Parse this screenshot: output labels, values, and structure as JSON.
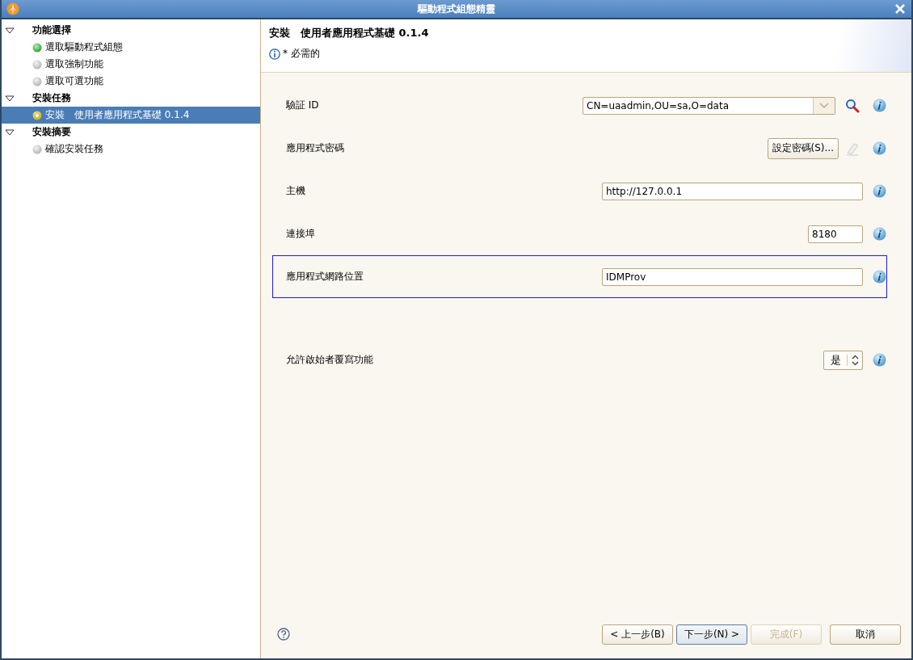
{
  "window": {
    "title": "驅動程式組態精靈"
  },
  "tree": [
    {
      "label": "功能選擇",
      "expanded": true,
      "children": [
        {
          "label": "選取驅動程式組態",
          "kind": "done",
          "selected": false
        },
        {
          "label": "選取強制功能",
          "kind": "pending",
          "selected": false
        },
        {
          "label": "選取可選功能",
          "kind": "pending",
          "selected": false
        }
      ]
    },
    {
      "label": "安裝任務",
      "expanded": true,
      "children": [
        {
          "label": "安裝　使用者應用程式基礎 0.1.4",
          "kind": "current",
          "selected": true
        }
      ]
    },
    {
      "label": "安裝摘要",
      "expanded": true,
      "children": [
        {
          "label": "確認安裝任務",
          "kind": "pending",
          "selected": false
        }
      ]
    }
  ],
  "header": {
    "title": "安裝　使用者應用程式基礎 0.1.4",
    "note": "* 必需的"
  },
  "fields": [
    {
      "kind": "combo",
      "label": "驗証 ID",
      "value": "CN=uaadmin,OU=sa,O=data",
      "focused": false
    },
    {
      "kind": "button",
      "label": "應用程式密碼",
      "value": "設定密碼(S)...",
      "focused": false
    },
    {
      "kind": "text",
      "label": "主機",
      "value": "http://127.0.0.1",
      "focused": false
    },
    {
      "kind": "port",
      "label": "連接埠",
      "value": "8180",
      "focused": false
    },
    {
      "kind": "text",
      "label": "應用程式網路位置",
      "value": "IDMProv",
      "focused": true
    },
    {
      "kind": "select",
      "label": "允許啟始者覆寫功能",
      "value": "是",
      "focused": false
    }
  ],
  "buttons": [
    {
      "label": "< 上一步(B)",
      "disabled": false,
      "default": false
    },
    {
      "label": "下一步(N) >",
      "disabled": false,
      "default": true
    },
    {
      "label": "完成(F)",
      "disabled": true,
      "default": false
    },
    {
      "label": "取消",
      "disabled": false,
      "default": false
    }
  ]
}
